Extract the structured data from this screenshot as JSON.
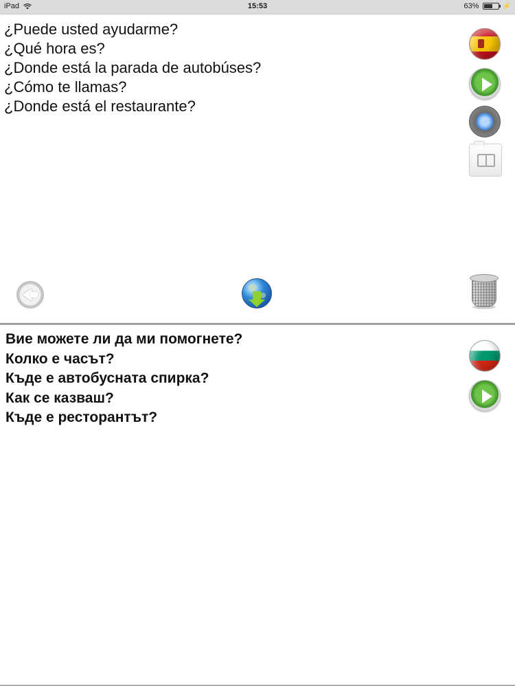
{
  "status_bar": {
    "device": "iPad",
    "time": "15:53",
    "battery": "63%",
    "battery_level": 0.63,
    "wifi_icon": "wifi-icon",
    "charging_icon": "bolt-icon"
  },
  "source_panel": {
    "language_flag": "spain-flag-icon",
    "phrases": [
      "¿Puede usted ayudarme?",
      "¿Qué hora es?",
      "¿Donde está la parada de autobúses?",
      "¿Cómo te llamas?",
      "¿Donde está el restaurante?"
    ],
    "buttons": [
      "play-icon",
      "record-icon",
      "book-icon"
    ]
  },
  "toolbar": {
    "back_icon": "back-arrow-icon",
    "globe_icon": "globe-download-icon",
    "trash_icon": "trash-icon"
  },
  "target_panel": {
    "language_flag": "bulgaria-flag-icon",
    "phrases": [
      "Вие можете ли да ми помогнете?",
      "Колко е часът?",
      "Къде е автобусната спирка?",
      "Как се казваш?",
      "Къде е ресторантът?"
    ],
    "buttons": [
      "play-icon"
    ]
  },
  "colors": {
    "status_bar_bg": "#dcdcdc",
    "divider": "#9f9f9f",
    "play_green": "#3b8f26",
    "record_blue": "#3d86e0"
  }
}
